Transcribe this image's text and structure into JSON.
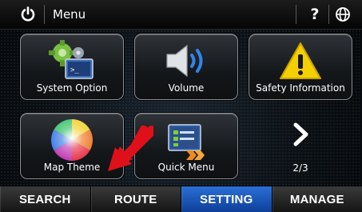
{
  "header": {
    "title": "Menu",
    "power_icon": "power-icon",
    "help_label": "?",
    "globe_icon": "globe-icon"
  },
  "tiles": [
    {
      "label": "System Option",
      "icon": "system-option-icon"
    },
    {
      "label": "Volume",
      "icon": "volume-icon"
    },
    {
      "label": "Safety Information",
      "icon": "warning-icon"
    },
    {
      "label": "Map Theme",
      "icon": "color-wheel-icon"
    },
    {
      "label": "Quick Menu",
      "icon": "quick-menu-icon"
    }
  ],
  "pager": {
    "next_icon": "chevron-right-icon",
    "label": "2/3"
  },
  "tabs": [
    {
      "label": "SEARCH",
      "active": false
    },
    {
      "label": "ROUTE",
      "active": false
    },
    {
      "label": "SETTING",
      "active": true
    },
    {
      "label": "MANAGE",
      "active": false
    }
  ],
  "colors": {
    "active_tab": "#1f5fc4",
    "arrow": "#e0101a",
    "warning": "#f4d000"
  }
}
